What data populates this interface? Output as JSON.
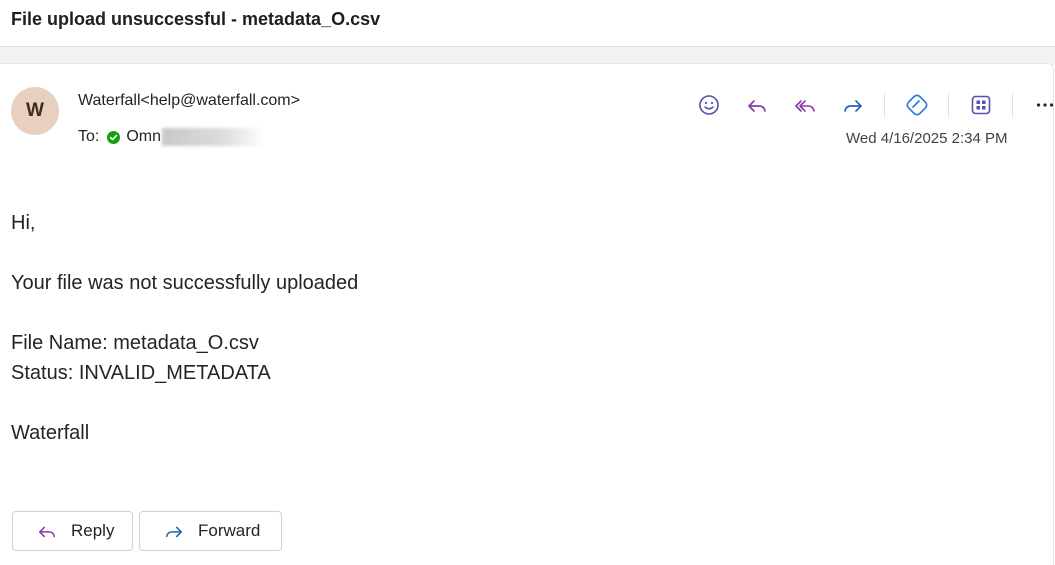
{
  "subject": "File upload unsuccessful - metadata_O.csv",
  "sender": {
    "avatar_initial": "W",
    "display": "Waterfall<help@waterfall.com>"
  },
  "recipients": {
    "label": "To:",
    "name_visible": "Omn"
  },
  "toolbar": {
    "items": [
      "smile-icon",
      "reply-icon",
      "reply-all-icon",
      "forward-icon",
      "loop-icon",
      "apps-icon",
      "more-icon"
    ]
  },
  "date": "Wed 4/16/2025 2:34 PM",
  "body": {
    "greeting": "Hi,",
    "message": "Your file was not successfully uploaded",
    "file_name": "File Name: metadata_O.csv",
    "status": "Status: INVALID_METADATA",
    "signature": "Waterfall"
  },
  "actions": {
    "reply_label": "Reply",
    "forward_label": "Forward"
  },
  "colors": {
    "accent": "#4f52b2",
    "reply_purple": "#8a3aa8",
    "forward_blue": "#2266b0",
    "presence_green": "#13a10e",
    "avatar_bg": "#e8cfbf"
  }
}
